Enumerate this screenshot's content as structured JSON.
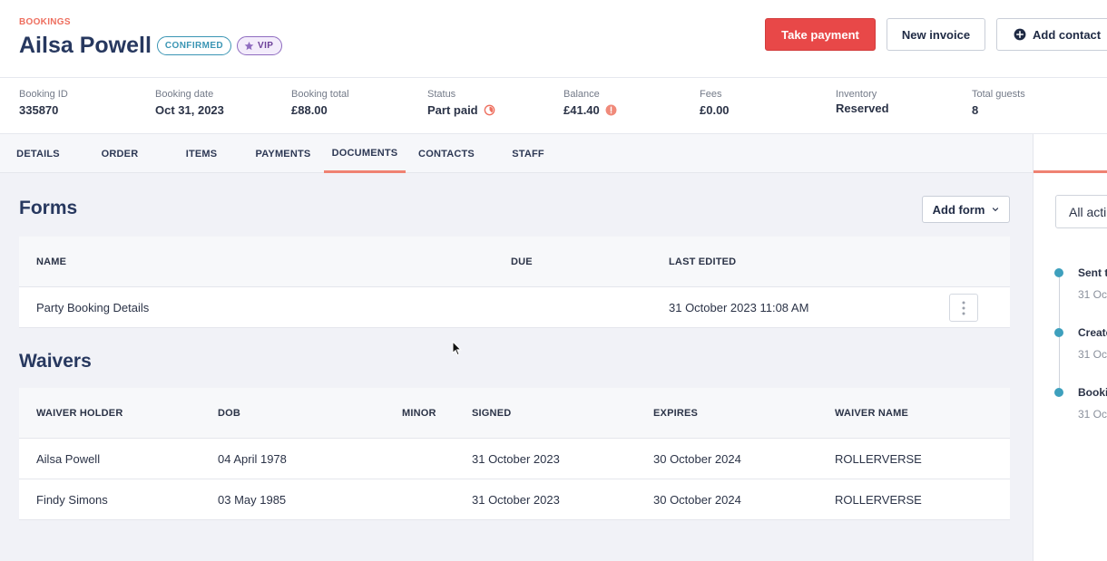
{
  "header": {
    "breadcrumb": "BOOKINGS",
    "title": "Ailsa Powell",
    "badges": {
      "confirmed": "CONFIRMED",
      "vip": "VIP"
    },
    "buttons": {
      "take_payment": "Take payment",
      "new_invoice": "New invoice",
      "add_contact": "Add contact"
    }
  },
  "summary": [
    {
      "label": "Booking ID",
      "value": "335870"
    },
    {
      "label": "Booking date",
      "value": "Oct 31, 2023"
    },
    {
      "label": "Booking total",
      "value": "£88.00"
    },
    {
      "label": "Status",
      "value": "Part paid"
    },
    {
      "label": "Balance",
      "value": "£41.40"
    },
    {
      "label": "Fees",
      "value": "£0.00"
    },
    {
      "label": "Inventory",
      "value": "Reserved"
    },
    {
      "label": "Total guests",
      "value": "8"
    }
  ],
  "tabs": [
    {
      "label": "DETAILS"
    },
    {
      "label": "ORDER"
    },
    {
      "label": "ITEMS"
    },
    {
      "label": "PAYMENTS"
    },
    {
      "label": "DOCUMENTS",
      "active": true
    },
    {
      "label": "CONTACTS"
    },
    {
      "label": "STAFF"
    }
  ],
  "forms": {
    "title": "Forms",
    "add_button": "Add form",
    "columns": [
      "NAME",
      "DUE",
      "LAST EDITED"
    ],
    "rows": [
      {
        "name": "Party Booking Details",
        "due": "",
        "last_edited": "31 October 2023 11:08 AM"
      }
    ]
  },
  "waivers": {
    "title": "Waivers",
    "columns": [
      "WAIVER HOLDER",
      "DOB",
      "MINOR",
      "SIGNED",
      "EXPIRES",
      "WAIVER NAME"
    ],
    "rows": [
      {
        "holder": "Ailsa Powell",
        "dob": "04 April 1978",
        "minor": "",
        "signed": "31 October 2023",
        "expires": "30 October 2024",
        "waiver_name": "ROLLERVERSE"
      },
      {
        "holder": "Findy Simons",
        "dob": "03 May 1985",
        "minor": "",
        "signed": "31 October 2023",
        "expires": "30 October 2024",
        "waiver_name": "ROLLERVERSE"
      }
    ]
  },
  "activity": {
    "filter": "All acti",
    "items": [
      {
        "title": "Sent t",
        "date": "31 Oc"
      },
      {
        "title": "Create",
        "date": "31 Oc"
      },
      {
        "title": "Booki",
        "date": "31 Oc"
      }
    ]
  },
  "colors": {
    "accent": "#ee6f5f",
    "primary_button": "#e84848",
    "heading": "#27385f",
    "timeline_dot": "#3ea0bd",
    "vip": "#8f6cc0"
  }
}
